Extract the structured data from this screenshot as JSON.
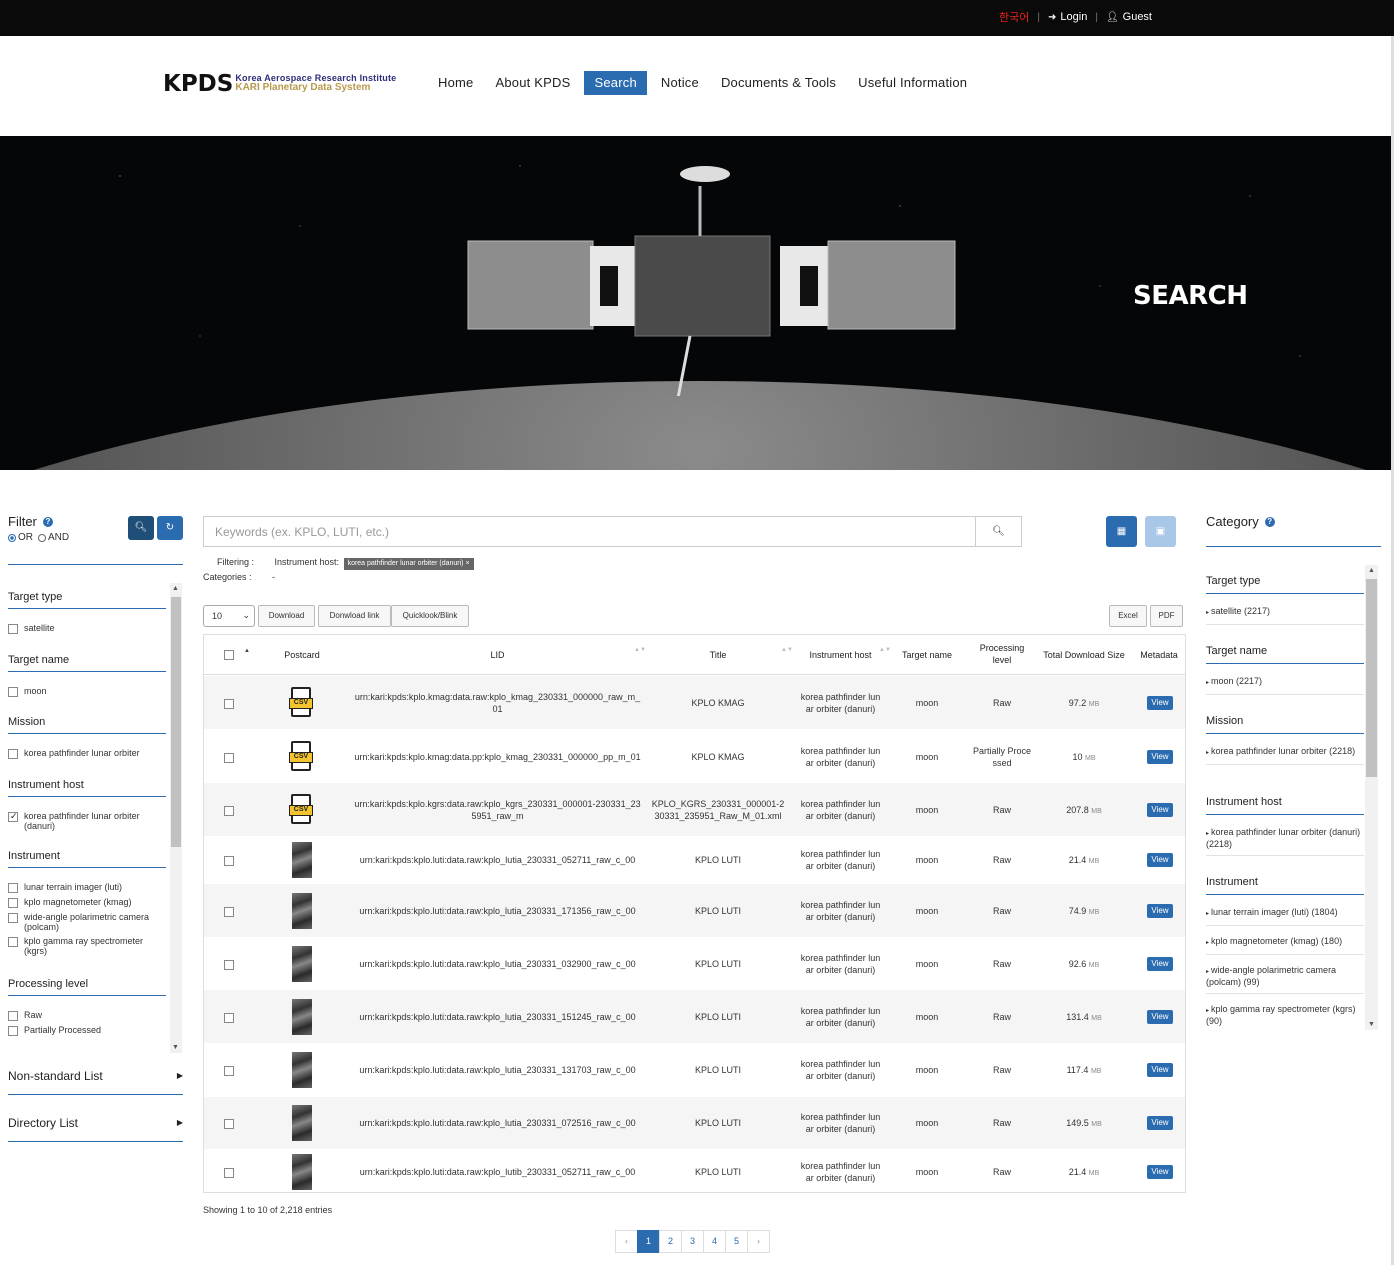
{
  "topbar": {
    "lang": "한국어",
    "login": "Login",
    "guest": "Guest"
  },
  "header": {
    "logo": {
      "text": "KPDS",
      "line1": "Korea Aerospace Research Institute",
      "line2": "KARI Planetary Data System"
    },
    "nav": [
      "Home",
      "About KPDS",
      "Search",
      "Notice",
      "Documents & Tools",
      "Useful Information"
    ],
    "active_nav": "Search"
  },
  "hero": {
    "title": "SEARCH"
  },
  "filter": {
    "title": "Filter",
    "or_label": "OR",
    "and_label": "AND",
    "sections": [
      {
        "name": "Target type",
        "options": [
          {
            "label": "satellite",
            "checked": false
          }
        ]
      },
      {
        "name": "Target name",
        "options": [
          {
            "label": "moon",
            "checked": false
          }
        ]
      },
      {
        "name": "Mission",
        "options": [
          {
            "label": "korea pathfinder lunar orbiter",
            "checked": false
          }
        ]
      },
      {
        "name": "Instrument host",
        "options": [
          {
            "label": "korea pathfinder lunar orbiter (danuri)",
            "checked": true
          }
        ]
      },
      {
        "name": "Instrument",
        "options": [
          {
            "label": "lunar terrain imager (luti)",
            "checked": false
          },
          {
            "label": "kplo magnetometer (kmag)",
            "checked": false
          },
          {
            "label": "wide-angle polarimetric camera (polcam)",
            "checked": false
          },
          {
            "label": "kplo gamma ray spectrometer (kgrs)",
            "checked": false
          }
        ]
      },
      {
        "name": "Processing level",
        "options": [
          {
            "label": "Raw",
            "checked": false
          },
          {
            "label": "Partially Processed",
            "checked": false
          }
        ]
      }
    ],
    "nonstandard": "Non-standard List",
    "directory": "Directory List"
  },
  "search": {
    "placeholder": "Keywords (ex. KPLO, LUTI, etc.)",
    "filtering_label": "Filtering :",
    "categories_label": "Categories :",
    "instrument_host_label": "Instrument host:",
    "tag": "korea pathfinder lunar orbiter (danuri) ×",
    "categories_value": "-"
  },
  "toolbar": {
    "page_size": "10",
    "download": "Download",
    "download_link": "Donwload link",
    "quicklook": "Quicklook/Blink",
    "excel": "Excel",
    "pdf": "PDF"
  },
  "table": {
    "headers": {
      "postcard": "Postcard",
      "lid": "LID",
      "title": "Title",
      "host": "Instrument host",
      "target": "Target name",
      "level": "Processing level",
      "size": "Total Download Size",
      "meta": "Metadata"
    },
    "rows": [
      {
        "postcard": "csv",
        "lid": "urn:kari:kpds:kplo.kmag:data.raw:kplo_kmag_230331_000000_raw_m_01",
        "title": "KPLO KMAG",
        "host": "korea pathfinder lunar orbiter (danuri)",
        "target": "moon",
        "level": "Raw",
        "size": "97.2",
        "unit": "MB",
        "view": "View"
      },
      {
        "postcard": "csv",
        "lid": "urn:kari:kpds:kplo.kmag:data.pp:kplo_kmag_230331_000000_pp_m_01",
        "title": "KPLO KMAG",
        "host": "korea pathfinder lunar orbiter (danuri)",
        "target": "moon",
        "level": "Partially Processed",
        "size": "10",
        "unit": "MB",
        "view": "View"
      },
      {
        "postcard": "csv",
        "lid": "urn:kari:kpds:kplo.kgrs:data.raw:kplo_kgrs_230331_000001-230331_235951_raw_m",
        "title": "KPLO_KGRS_230331_000001-230331_235951_Raw_M_01.xml",
        "host": "korea pathfinder lunar orbiter (danuri)",
        "target": "moon",
        "level": "Raw",
        "size": "207.8",
        "unit": "MB",
        "view": "View"
      },
      {
        "postcard": "img",
        "lid": "urn:kari:kpds:kplo.luti:data.raw:kplo_lutia_230331_052711_raw_c_00",
        "title": "KPLO LUTI",
        "host": "korea pathfinder lunar orbiter (danuri)",
        "target": "moon",
        "level": "Raw",
        "size": "21.4",
        "unit": "MB",
        "view": "View"
      },
      {
        "postcard": "img",
        "lid": "urn:kari:kpds:kplo.luti:data.raw:kplo_lutia_230331_171356_raw_c_00",
        "title": "KPLO LUTI",
        "host": "korea pathfinder lunar orbiter (danuri)",
        "target": "moon",
        "level": "Raw",
        "size": "74.9",
        "unit": "MB",
        "view": "View"
      },
      {
        "postcard": "img",
        "lid": "urn:kari:kpds:kplo.luti:data.raw:kplo_lutia_230331_032900_raw_c_00",
        "title": "KPLO LUTI",
        "host": "korea pathfinder lunar orbiter (danuri)",
        "target": "moon",
        "level": "Raw",
        "size": "92.6",
        "unit": "MB",
        "view": "View"
      },
      {
        "postcard": "img",
        "lid": "urn:kari:kpds:kplo.luti:data.raw:kplo_lutia_230331_151245_raw_c_00",
        "title": "KPLO LUTI",
        "host": "korea pathfinder lunar orbiter (danuri)",
        "target": "moon",
        "level": "Raw",
        "size": "131.4",
        "unit": "MB",
        "view": "View"
      },
      {
        "postcard": "img",
        "lid": "urn:kari:kpds:kplo.luti:data.raw:kplo_lutia_230331_131703_raw_c_00",
        "title": "KPLO LUTI",
        "host": "korea pathfinder lunar orbiter (danuri)",
        "target": "moon",
        "level": "Raw",
        "size": "117.4",
        "unit": "MB",
        "view": "View"
      },
      {
        "postcard": "img",
        "lid": "urn:kari:kpds:kplo.luti:data.raw:kplo_lutia_230331_072516_raw_c_00",
        "title": "KPLO LUTI",
        "host": "korea pathfinder lunar orbiter (danuri)",
        "target": "moon",
        "level": "Raw",
        "size": "149.5",
        "unit": "MB",
        "view": "View"
      },
      {
        "postcard": "img",
        "lid": "urn:kari:kpds:kplo.luti:data.raw:kplo_lutib_230331_052711_raw_c_00",
        "title": "KPLO LUTI",
        "host": "korea pathfinder lunar orbiter (danuri)",
        "target": "moon",
        "level": "Raw",
        "size": "21.4",
        "unit": "MB",
        "view": "View"
      }
    ],
    "showing": "Showing 1 to 10 of 2,218 entries"
  },
  "pager": {
    "prev": "‹",
    "pages": [
      "1",
      "2",
      "3",
      "4",
      "5"
    ],
    "current": "1",
    "next": "›"
  },
  "category": {
    "title": "Category",
    "sections": [
      {
        "name": "Target type",
        "items": [
          "satellite (2217)"
        ]
      },
      {
        "name": "Target name",
        "items": [
          "moon (2217)"
        ]
      },
      {
        "name": "Mission",
        "items": [
          "korea pathfinder lunar orbiter (2218)"
        ]
      },
      {
        "name": "Instrument host",
        "items": [
          "korea pathfinder lunar orbiter (danuri) (2218)"
        ]
      },
      {
        "name": "Instrument",
        "items": [
          "lunar terrain imager (luti) (1804)",
          "kplo magnetometer (kmag) (180)",
          "wide-angle polarimetric camera (polcam) (99)",
          "kplo gamma ray spectrometer (kgrs) (90)"
        ]
      }
    ]
  },
  "colors": {
    "accent": "#2b6cb0",
    "topbar": "#0a0a0a",
    "lang": "#e8231b"
  }
}
